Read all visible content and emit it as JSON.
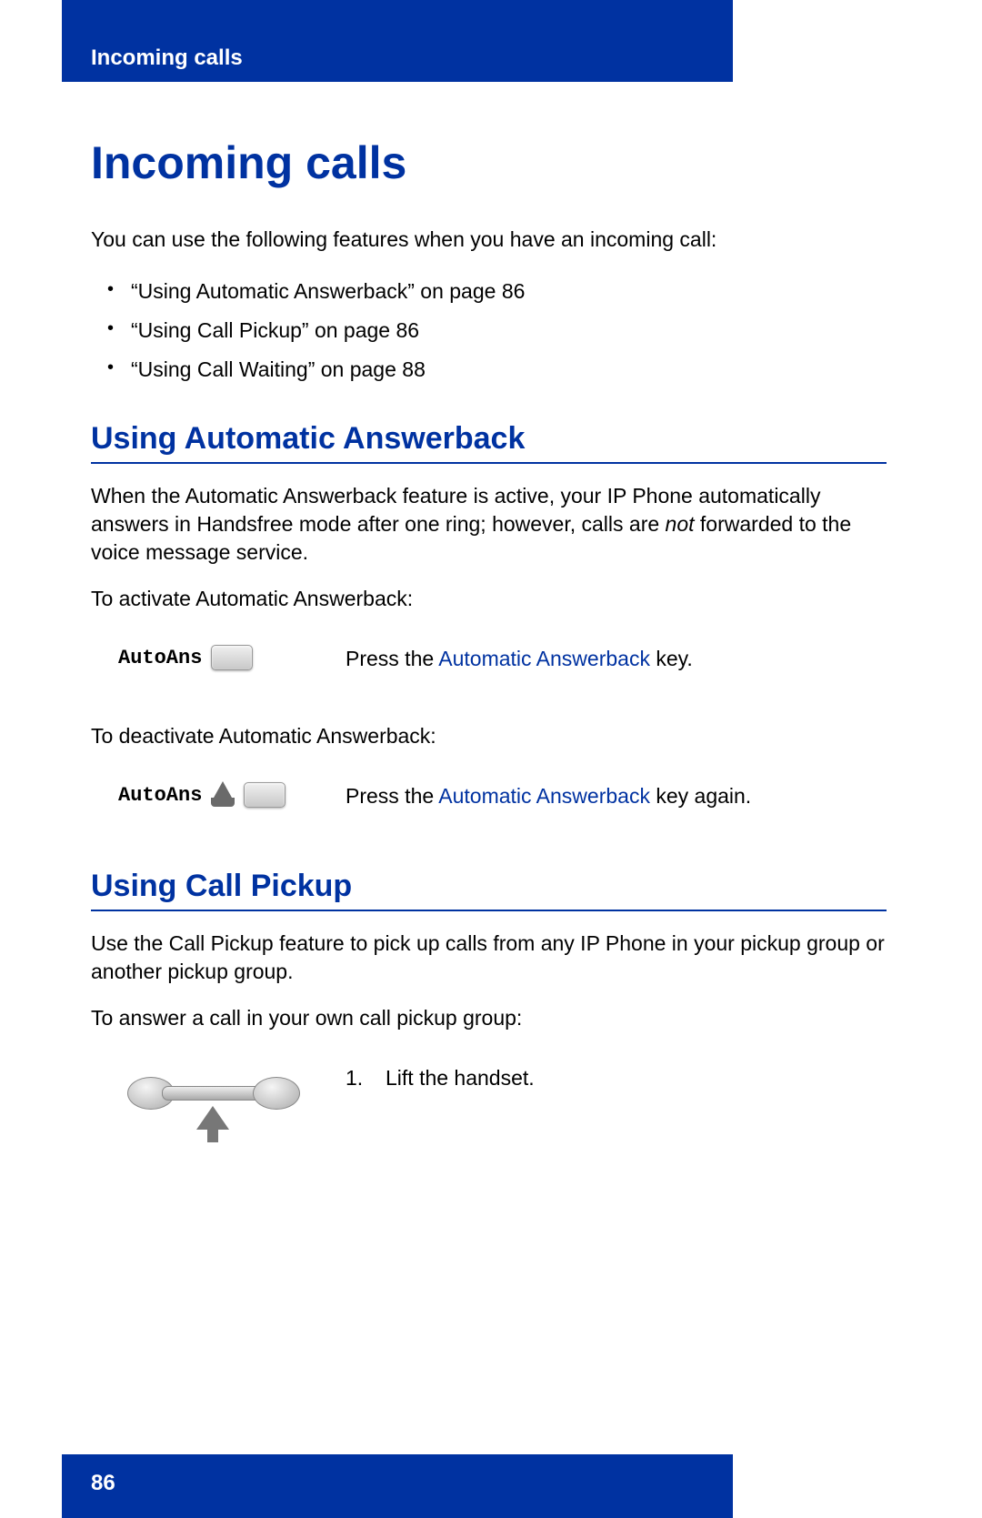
{
  "header": {
    "running_title": "Incoming calls"
  },
  "footer": {
    "page_number": "86"
  },
  "title": "Incoming calls",
  "intro": "You can use the following features when you have an incoming call:",
  "feature_list": [
    "“Using Automatic Answerback” on page 86",
    "“Using Call Pickup” on page 86",
    "“Using Call Waiting” on page 88"
  ],
  "section1": {
    "heading": "Using Automatic Answerback",
    "para1_a": "When the Automatic Answerback feature is active, your IP Phone automatically answers in Handsfree mode after one ring; however, calls are ",
    "para1_em": "not",
    "para1_b": " forwarded to the voice message service.",
    "activate_intro": "To activate Automatic Answerback:",
    "step1": {
      "key_label": "AutoAns",
      "text_a": "Press the ",
      "text_link": "Automatic Answerback",
      "text_b": "    key."
    },
    "deactivate_intro": "To deactivate Automatic Answerback:",
    "step2": {
      "key_label": "AutoAns",
      "text_a": "Press the ",
      "text_link": "Automatic Answerback",
      "text_b": "    key again."
    }
  },
  "section2": {
    "heading": "Using Call Pickup",
    "para1": "Use the Call Pickup feature to pick up calls from any IP Phone in your pickup group or another pickup group.",
    "intro": "To answer a call in your own call pickup group:",
    "step1": {
      "num": "1.",
      "text": "Lift the handset."
    }
  }
}
